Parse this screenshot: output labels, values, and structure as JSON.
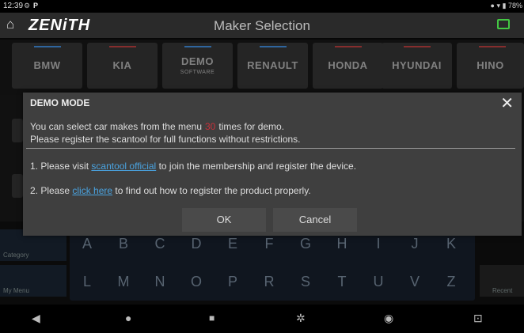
{
  "status": {
    "time": "12:39",
    "battery": "78%"
  },
  "header": {
    "logo": "ZENiTH",
    "title": "Maker Selection"
  },
  "brands": [
    "BMW",
    "KIA",
    "DEMO",
    "RENAULT",
    "HONDA",
    "HYUNDAI",
    "HINO"
  ],
  "brand_demo_sub": "SOFTWARE",
  "keyboard": {
    "row1": [
      "A",
      "B",
      "C",
      "D",
      "E",
      "F",
      "G",
      "H",
      "I",
      "J",
      "K"
    ],
    "row2": [
      "L",
      "M",
      "N",
      "O",
      "P",
      "R",
      "S",
      "T",
      "U",
      "V",
      "Z"
    ],
    "left_buttons": [
      "Category",
      "My Menu"
    ],
    "right_button": "Recent"
  },
  "dialog": {
    "title": "DEMO MODE",
    "line1_before": "You can select car makes from the menu",
    "demo_count": "30",
    "line1_after": "times for demo.",
    "line2": "Please register the scantool for full functions without restrictions.",
    "step1_before": "1. Please visit",
    "step1_link": "scantool official",
    "step1_after": "to join the membership and register the device.",
    "step2_before": "2. Please",
    "step2_link": "click here",
    "step2_after": "to find out how to register the product properly.",
    "ok_label": "OK",
    "cancel_label": "Cancel"
  },
  "colors": {
    "accent_blue": "#4da3ff",
    "accent_red": "#d84a4a",
    "link": "#4aa3e0",
    "battery_green": "#43c843"
  }
}
